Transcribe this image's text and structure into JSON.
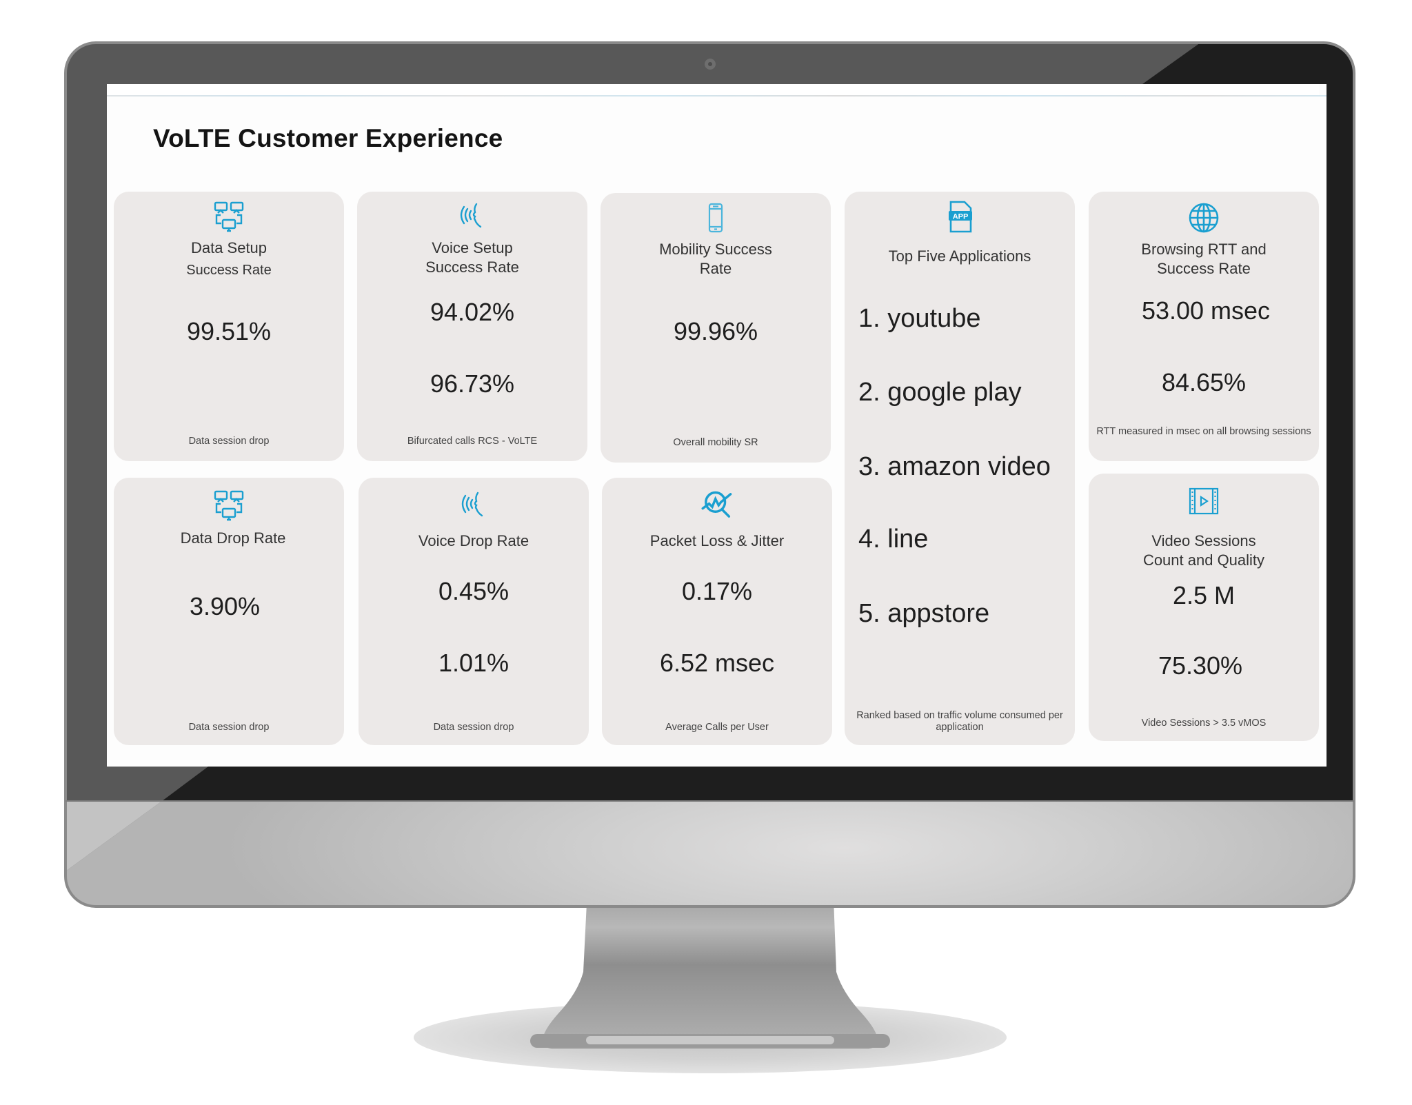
{
  "dashboard": {
    "title": "VoLTE Customer Experience",
    "accent_color": "#1a9fd0",
    "cards": {
      "data_setup": {
        "icon": "network-computers-icon",
        "title_line1": "Data Setup",
        "title_line2": "Success Rate",
        "value1": "99.51%",
        "footnote": "Data session drop"
      },
      "voice_setup": {
        "icon": "speaking-head-icon",
        "title_line1": "Voice Setup",
        "title_line2": "Success Rate",
        "value1": "94.02%",
        "value2": "96.73%",
        "footnote": "Bifurcated calls RCS - VoLTE"
      },
      "mobility": {
        "icon": "smartphone-icon",
        "title_line1": "Mobility Success",
        "title_line2": "Rate",
        "value1": "99.96%",
        "footnote": "Overall mobility SR"
      },
      "top_apps": {
        "icon": "app-file-icon",
        "title": "Top Five Applications",
        "items": [
          "1. youtube",
          "2. google play",
          "3. amazon video",
          "4. line",
          "5. appstore"
        ],
        "footnote": "Ranked based on traffic volume consumed per application"
      },
      "browsing": {
        "icon": "globe-icon",
        "title_line1": "Browsing RTT and",
        "title_line2": "Success Rate",
        "value1": "53.00 msec",
        "value2": "84.65%",
        "footnote": "RTT measured in msec on all browsing sessions"
      },
      "data_drop": {
        "icon": "network-computers-icon",
        "title_line1": "Data Drop Rate",
        "value1": "3.90%",
        "footnote": "Data session drop"
      },
      "voice_drop": {
        "icon": "speaking-head-icon",
        "title_line1": "Voice Drop Rate",
        "value1": "0.45%",
        "value2": "1.01%",
        "footnote": "Data session drop"
      },
      "packet_loss": {
        "icon": "magnifier-pulse-icon",
        "title_line1": "Packet Loss & Jitter",
        "value1": "0.17%",
        "value2": "6.52 msec",
        "footnote": "Average Calls per  User"
      },
      "video": {
        "icon": "video-film-icon",
        "title_line1": "Video Sessions",
        "title_line2": "Count and Quality",
        "value1": "2.5 M",
        "value2": "75.30%",
        "footnote": "Video Sessions > 3.5 vMOS"
      }
    }
  }
}
